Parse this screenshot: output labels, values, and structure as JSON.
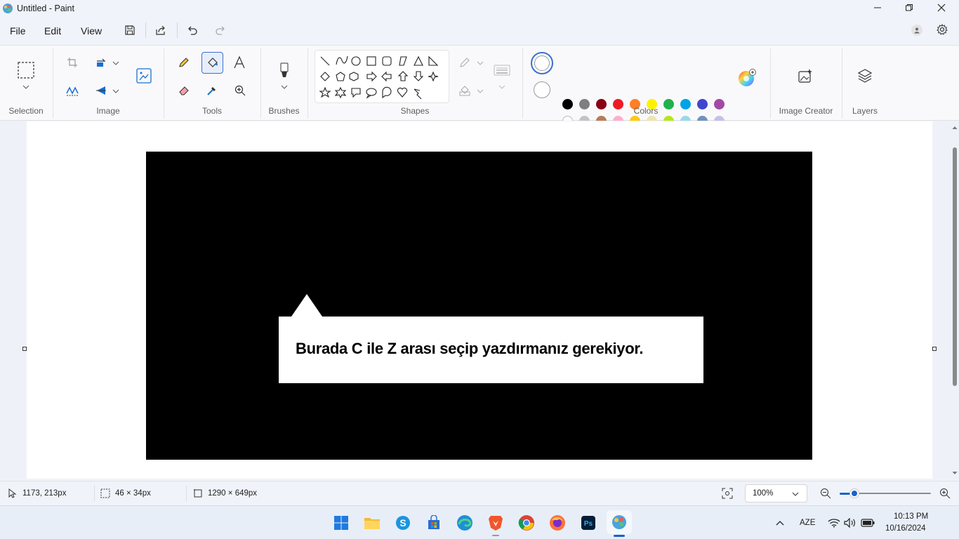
{
  "window": {
    "title": "Untitled - Paint"
  },
  "menu": {
    "file": "File",
    "edit": "Edit",
    "view": "View"
  },
  "ribbon": {
    "groups": {
      "selection": "Selection",
      "image": "Image",
      "tools": "Tools",
      "brushes": "Brushes",
      "shapes": "Shapes",
      "colors": "Colors",
      "image_creator": "Image Creator",
      "layers": "Layers"
    }
  },
  "colors": {
    "row1": [
      "#000000",
      "#7f7f7f",
      "#880015",
      "#ed1c24",
      "#ff7f27",
      "#fff200",
      "#22b14c",
      "#00a2e8",
      "#3f48cc",
      "#a349a4"
    ],
    "row2": [
      "#ffffff",
      "#c3c3c3",
      "#b97a57",
      "#ffaec9",
      "#ffc90e",
      "#efe4b0",
      "#b5e61d",
      "#99d9ea",
      "#7092be",
      "#c8bfe7"
    ]
  },
  "canvas": {
    "callout_text": "Burada C ile Z arası seçip yazdırmanız gerekiyor."
  },
  "status": {
    "cursor_pos": "1173, 213px",
    "selection_size": "46 × 34px",
    "canvas_size": "1290 × 649px",
    "zoom": "100%"
  },
  "taskbar": {
    "lang": "AZE",
    "time": "10:13 PM",
    "date": "10/16/2024"
  }
}
